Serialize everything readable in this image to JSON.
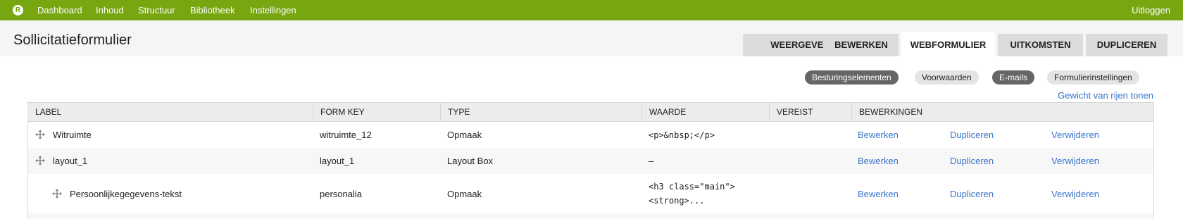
{
  "toolbar": {
    "logo_letter": "R",
    "nav": [
      "Dashboard",
      "Inhoud",
      "Structuur",
      "Bibliotheek",
      "Instellingen"
    ],
    "logout": "Uitloggen"
  },
  "header": {
    "title": "Sollicitatieformulier",
    "tabs": [
      "WEERGEVEN",
      "BEWERKEN",
      "WEBFORMULIER",
      "UITKOMSTEN",
      "DUPLICEREN"
    ],
    "active_tab": "WEBFORMULIER"
  },
  "subtabs": [
    "Besturingselementen",
    "Voorwaarden",
    "E-mails",
    "Formulierinstellingen"
  ],
  "weight_link": "Gewicht van rijen tonen",
  "table": {
    "columns": [
      "LABEL",
      "FORM KEY",
      "TYPE",
      "WAARDE",
      "VEREIST",
      "BEWERKINGEN"
    ],
    "rows": [
      {
        "label": "Witruimte",
        "form_key": "witruimte_12",
        "type": "Opmaak",
        "value": "<p>&nbsp;</p>",
        "required": "",
        "actions": [
          "Bewerken",
          "Dupliceren",
          "Verwijderen"
        ]
      },
      {
        "label": "layout_1",
        "form_key": "layout_1",
        "type": "Layout Box",
        "value": "–",
        "required": "",
        "actions": [
          "Bewerken",
          "Dupliceren",
          "Verwijderen"
        ]
      },
      {
        "label": "Persoonlijkegegevens-tekst",
        "form_key": "personalia",
        "type": "Opmaak",
        "value_line1": "<h3 class=\"main\">",
        "value_line2": "<strong>...",
        "required": "",
        "actions": [
          "Bewerken",
          "Dupliceren",
          "Verwijderen"
        ]
      }
    ]
  },
  "colors": {
    "toolbar_bg": "#77a610",
    "link": "#3b74c8",
    "pill_active": "#666666"
  }
}
